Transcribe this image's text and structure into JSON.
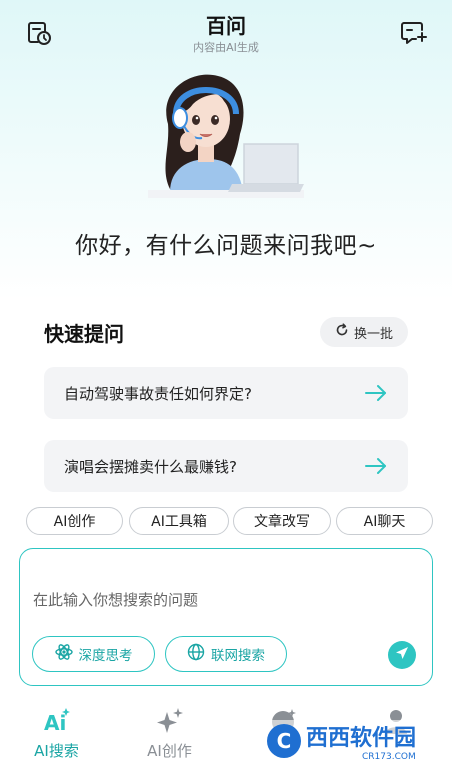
{
  "header": {
    "title": "百问",
    "subtitle": "内容由AI生成",
    "history_icon": "history-clock-icon",
    "new_chat_icon": "new-chat-icon"
  },
  "greeting": "你好，有什么问题来问我吧~",
  "quick": {
    "title": "快速提问",
    "refresh_label": "换一批",
    "questions": [
      "自动驾驶事故责任如何界定?",
      "演唱会摆摊卖什么最赚钱?"
    ]
  },
  "chips": [
    "AI创作",
    "AI工具箱",
    "文章改写",
    "AI聊天"
  ],
  "input": {
    "placeholder": "在此输入你想搜索的问题",
    "deep_think_label": "深度思考",
    "web_search_label": "联网搜索"
  },
  "tabs": [
    {
      "label": "AI搜索",
      "active": true,
      "icon": "ai-search-icon"
    },
    {
      "label": "AI创作",
      "active": false,
      "icon": "sparkle-icon"
    },
    {
      "label": "",
      "active": false,
      "icon": "discover-icon"
    },
    {
      "label": "",
      "active": false,
      "icon": "user-icon"
    }
  ],
  "watermark": {
    "main": "西西软件园",
    "sub": "CR173.COM"
  },
  "colors": {
    "accent": "#2ec5c2",
    "accent_text": "#1aa5a4",
    "card_bg": "#f3f4f6"
  }
}
